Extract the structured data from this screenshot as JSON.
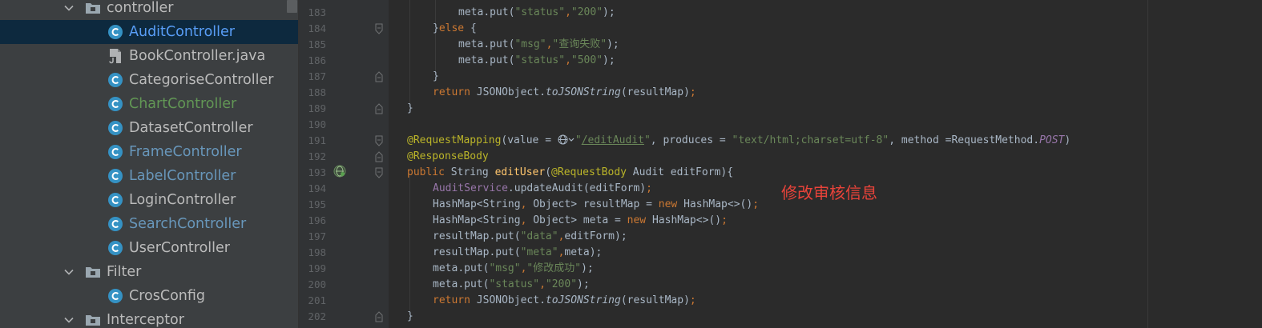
{
  "sidebar": {
    "items": [
      {
        "label": "controller",
        "kind": "folder",
        "expanded": true,
        "color": "#bbbbbb"
      },
      {
        "label": "AuditController",
        "kind": "class",
        "selected": true,
        "color": "#589df6"
      },
      {
        "label": "BookController.java",
        "kind": "java-file",
        "color": "#bbbbbb"
      },
      {
        "label": "CategoriseController",
        "kind": "class",
        "color": "#bbbbbb"
      },
      {
        "label": "ChartController",
        "kind": "class",
        "color": "#629755"
      },
      {
        "label": "DatasetController",
        "kind": "class",
        "color": "#bbbbbb"
      },
      {
        "label": "FrameController",
        "kind": "class",
        "color": "#6897bb"
      },
      {
        "label": "LabelController",
        "kind": "class",
        "color": "#6897bb"
      },
      {
        "label": "LoginController",
        "kind": "class",
        "color": "#bbbbbb"
      },
      {
        "label": "SearchController",
        "kind": "class",
        "color": "#6897bb"
      },
      {
        "label": "UserController",
        "kind": "class",
        "color": "#bbbbbb"
      },
      {
        "label": "Filter",
        "kind": "folder",
        "expanded": true,
        "color": "#bbbbbb"
      },
      {
        "label": "CrosConfig",
        "kind": "class",
        "color": "#bbbbbb"
      },
      {
        "label": "Interceptor",
        "kind": "folder",
        "expanded": true,
        "color": "#bbbbbb"
      }
    ]
  },
  "editor": {
    "line_numbers": [
      "183",
      "184",
      "185",
      "186",
      "187",
      "188",
      "189",
      "190",
      "191",
      "192",
      "193",
      "194",
      "195",
      "196",
      "197",
      "198",
      "199",
      "200",
      "201",
      "202"
    ],
    "text": {
      "meta": "meta",
      "put": ".put(",
      "comma": ",",
      "close_semi": ");",
      "k_msg": "\"msg\"",
      "k_status": "\"status\"",
      "k_data": "\"data\"",
      "k_meta": "\"meta\"",
      "v_200": "\"200\"",
      "v_500": "\"500\"",
      "v_query_fail": "\"查询失败\"",
      "v_edit_ok": "\"修改成功\"",
      "close_brace": "}",
      "close_brace_else": "}else {",
      "else_kw": "else",
      "return_kw": "return",
      "json_obj": "JSONObject.",
      "to_json": "toJSONString",
      "result_map_arg": "(resultMap)",
      "semi": ";",
      "request_mapping": "@RequestMapping",
      "value_eq": "(value = ",
      "path_open_quote": "\"",
      "path": "/editAudit",
      "path_close_quote": "\"",
      "produces_eq": ", produces = ",
      "content_type": "\"text/html;charset=utf-8\"",
      "method_eq": ", method =RequestMethod.",
      "post": "POST",
      "rparen": ")",
      "response_body": "@ResponseBody",
      "public_kw": "public",
      "string_type": " String ",
      "method_name": "editUser",
      "lparen": "(",
      "request_body": "@RequestBody",
      "param": " Audit editForm){",
      "audit_service": "AuditService",
      "update_call": ".updateAudit(editForm)",
      "hashmap_decl": "HashMap<String",
      "object_type": " Object> ",
      "result_map_var": "resultMap = ",
      "meta_var": "meta = ",
      "new_kw": "new",
      "new_hashmap": " HashMap<>()",
      "result_map": "resultMap",
      "edit_form": "editForm",
      "meta_arg": "meta"
    }
  },
  "annotation": {
    "text": "修改审核信息",
    "color": "#e8433a"
  },
  "icons": {
    "tree_expand": "chevron-down-icon",
    "folder": "folder-icon",
    "class": "java-class-icon",
    "java_file": "java-file-icon",
    "web_endpoint": "web-endpoint-gutter-icon",
    "fold": "fold-marker-icon"
  },
  "colors": {
    "editor_bg": "#2b2b2b",
    "sidebar_bg": "#3c3f41",
    "selected_row": "#0d293e",
    "keyword": "#cc7832",
    "string": "#6a8759",
    "annotation": "#bbb529",
    "method_decl": "#ffc66d",
    "static_ref": "#9876aa"
  }
}
